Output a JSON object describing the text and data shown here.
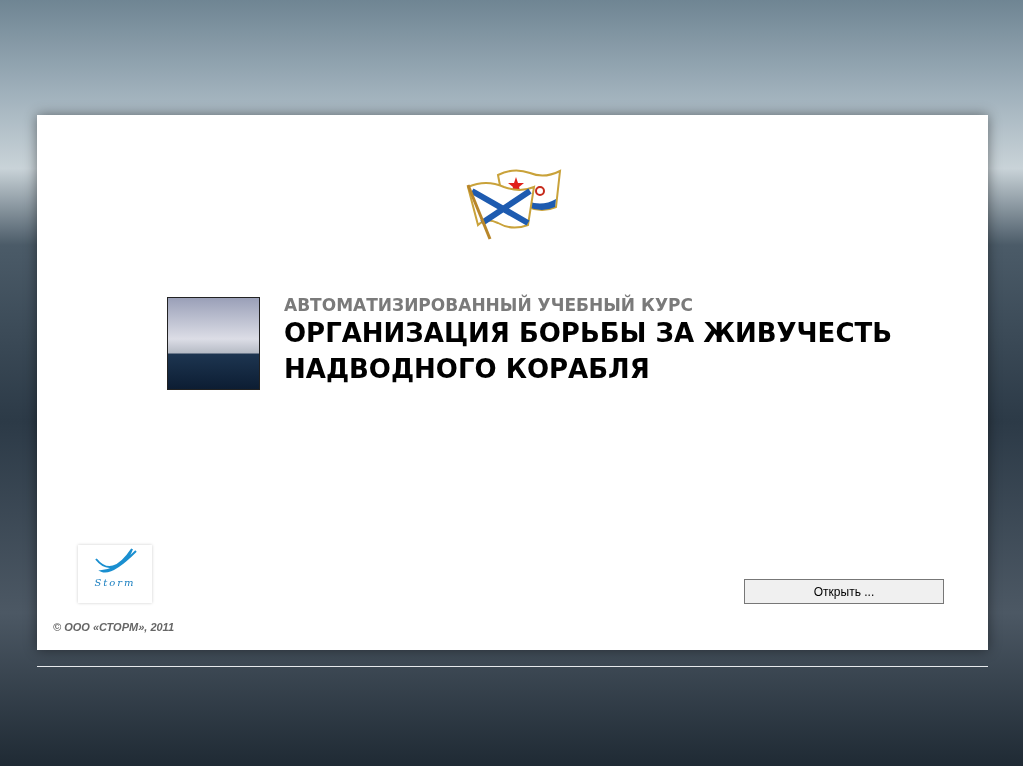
{
  "course": {
    "subtitle": "АВТОМАТИЗИРОВАННЫЙ УЧЕБНЫЙ КУРС",
    "title_lines": [
      "ОРГАНИЗАЦИЯ БОРЬБЫ ЗА ЖИВУЧЕСТЬ",
      "НАДВОДНОГО КОРАБЛЯ"
    ]
  },
  "logo": {
    "text": "Storm"
  },
  "copyright": "© ООО «СТОРМ», 2011",
  "open_button": {
    "label": "Открыть ..."
  }
}
